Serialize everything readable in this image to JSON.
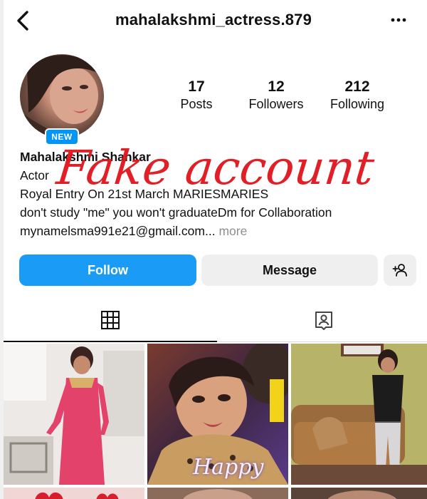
{
  "header": {
    "username": "mahalakshmi_actress.879",
    "back_icon": "chevron-left-icon",
    "more_icon": "more-horizontal-icon"
  },
  "profile": {
    "badge": "NEW",
    "stats": [
      {
        "value": "17",
        "label": "Posts"
      },
      {
        "value": "12",
        "label": "Followers"
      },
      {
        "value": "212",
        "label": "Following"
      }
    ],
    "name": "Mahalakshmi Shankar",
    "category": "Actor",
    "bio_line1": "Royal Entry On 21st March MARIESMARIES",
    "bio_line2": "don't study \"me\" you won't graduateDm for Collaboration",
    "bio_line3": "mynamelsma991e21@gmail.com",
    "bio_ellipsis": "...",
    "more_label": "more"
  },
  "overlay": {
    "watermark": "Fake account",
    "color": "#e0141c"
  },
  "actions": {
    "follow_label": "Follow",
    "message_label": "Message",
    "add_user_icon": "add-person-icon"
  },
  "tabs": [
    {
      "icon": "grid-icon",
      "active": true
    },
    {
      "icon": "tagged-person-icon",
      "active": false
    }
  ],
  "posts": {
    "caption_happy": "Happy"
  },
  "colors": {
    "accent": "#1a9bf6",
    "badge": "#0095f6",
    "secondary_button": "#efefef"
  }
}
